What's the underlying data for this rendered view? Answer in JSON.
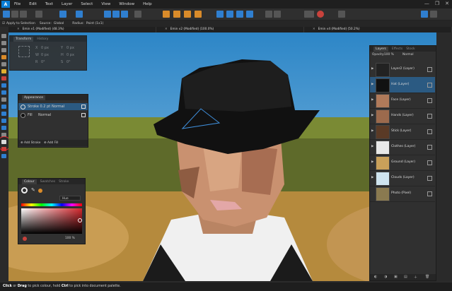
{
  "app": {
    "logo_letter": "A",
    "menu": [
      "File",
      "Edit",
      "Text",
      "Layer",
      "Select",
      "View",
      "Window",
      "Help"
    ],
    "window_controls": [
      "—",
      "❐",
      "✕"
    ]
  },
  "context_bar": {
    "apply_label": "Apply to Selection",
    "source_label": "Source:",
    "source_value": "Global",
    "radius_label": "Radius:",
    "radius_value": "Point (1x1)"
  },
  "document_tabs": [
    {
      "label": "Emin v1 (Modified) (48.3%)"
    },
    {
      "label": "Emin v2 (Modified) (100.0%)"
    },
    {
      "label": "Emin v4 (Modified) (50.2%)"
    }
  ],
  "transform_panel": {
    "tabs": [
      "Transform",
      "History"
    ],
    "fields": [
      {
        "label": "X",
        "value": "0 px"
      },
      {
        "label": "Y",
        "value": "0 px"
      },
      {
        "label": "W",
        "value": "0 px"
      },
      {
        "label": "H",
        "value": "0 px"
      },
      {
        "label": "R",
        "value": "0°"
      },
      {
        "label": "S",
        "value": "0°"
      }
    ]
  },
  "appearance_panel": {
    "tab": "Appearance",
    "stroke_label": "Stroke 0.2 pt",
    "stroke_mode": "Normal",
    "fill_label": "Fill",
    "fill_mode": "Normal",
    "add_stroke": "Add Stroke",
    "add_fill": "Add Fill"
  },
  "colour_panel": {
    "tabs": [
      "Colour",
      "Swatches",
      "Stroke"
    ],
    "model": "Hue",
    "opacity": "100 %",
    "accent_color": "#d4272d"
  },
  "layers_panel": {
    "tabs": [
      "Layers",
      "Effects",
      "Stock"
    ],
    "opacity_label": "Opacity:",
    "opacity_value": "100 %",
    "blend_mode": "Normal",
    "layers": [
      {
        "name": "Layer2 (Layer)",
        "checked": true,
        "selected": false
      },
      {
        "name": "Hat (Layer)",
        "checked": true,
        "selected": true
      },
      {
        "name": "Face (Layer)",
        "checked": true,
        "selected": false
      },
      {
        "name": "Hands (Layer)",
        "checked": true,
        "selected": false
      },
      {
        "name": "Stick (Layer)",
        "checked": true,
        "selected": false
      },
      {
        "name": "Clothes (Layer)",
        "checked": true,
        "selected": false
      },
      {
        "name": "Ground (Layer)",
        "checked": true,
        "selected": false
      },
      {
        "name": "Clouds (Layer)",
        "checked": true,
        "selected": false
      },
      {
        "name": "Photo (Pixel)",
        "checked": true,
        "selected": false
      }
    ]
  },
  "status": {
    "prefix_bold": "Click",
    "text1": " or ",
    "drag_bold": "Drag",
    "text2": " to pick colour, hold ",
    "ctrl_bold": "Ctrl",
    "text3": " to pick into document palette."
  }
}
